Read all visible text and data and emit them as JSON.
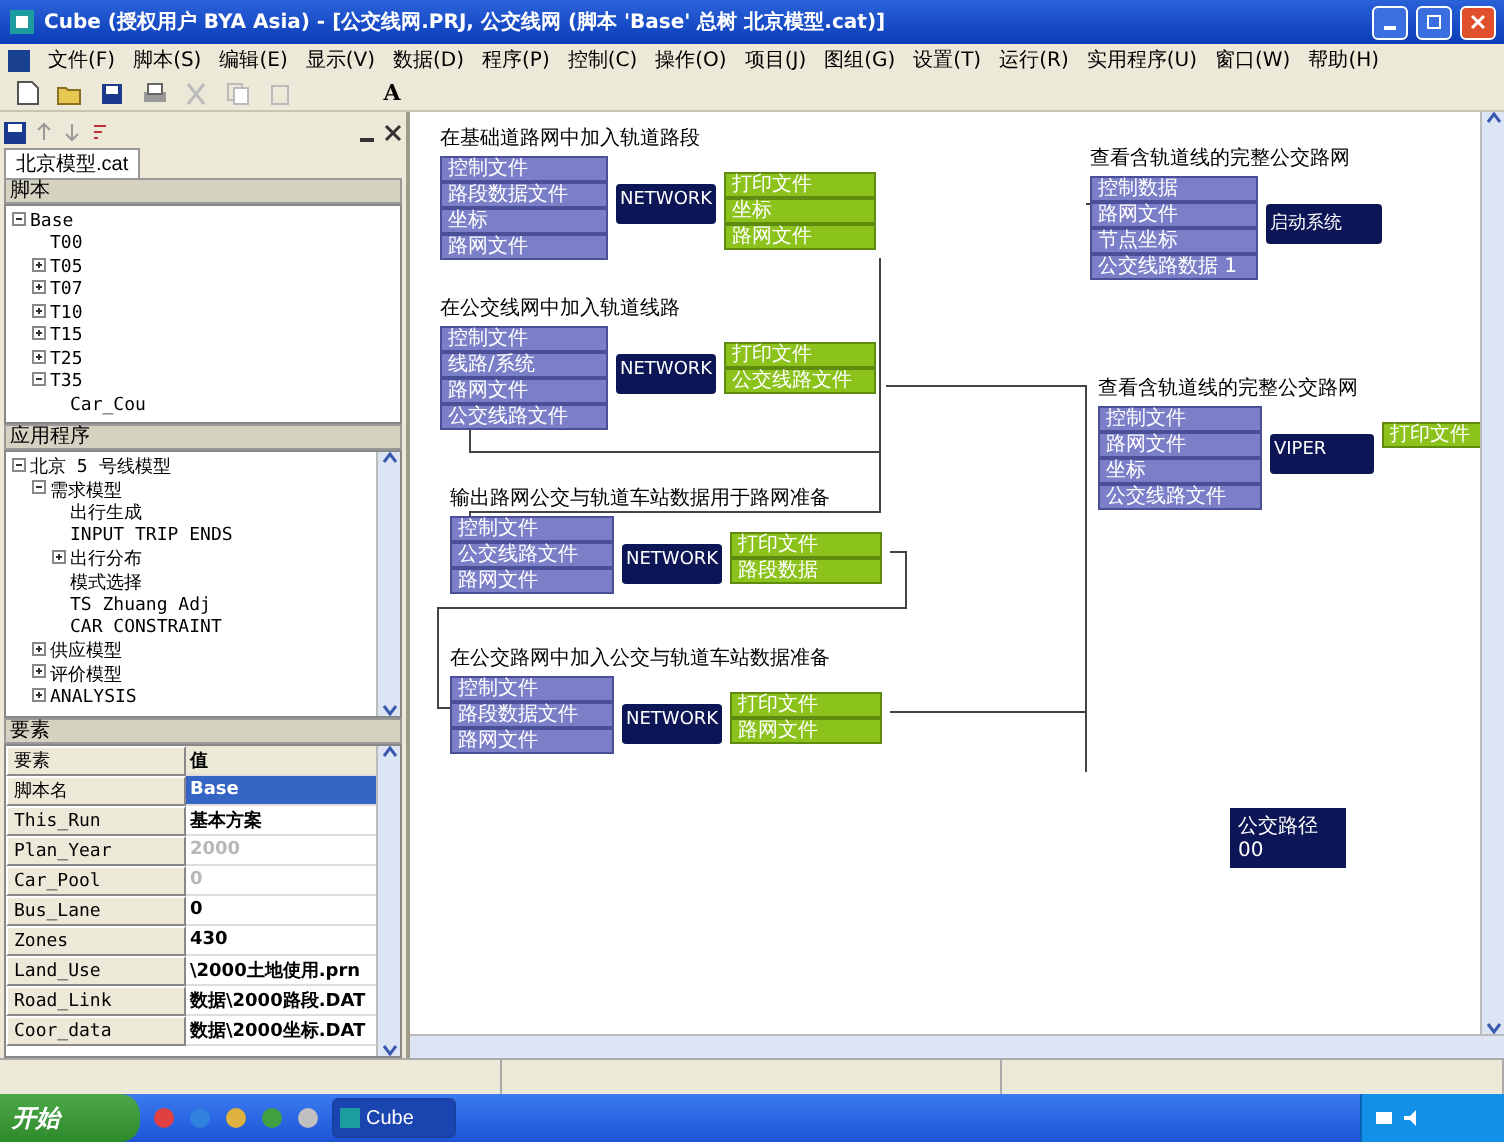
{
  "window": {
    "title": "Cube (授权用户 BYA Asia) - [公交线网.PRJ, 公交线网 (脚本 'Base' 总树 北京模型.cat)]"
  },
  "menu": [
    "文件(F)",
    "脚本(S)",
    "编辑(E)",
    "显示(V)",
    "数据(D)",
    "程序(P)",
    "控制(C)",
    "操作(O)",
    "项目(J)",
    "图组(G)",
    "设置(T)",
    "运行(R)",
    "实用程序(U)",
    "窗口(W)",
    "帮助(H)"
  ],
  "toolbar": {
    "font_button": "A"
  },
  "left_panel": {
    "tab": "北京模型.cat",
    "scripts": {
      "heading": "脚本",
      "tree": [
        {
          "label": "Base",
          "expanded": true,
          "children": [
            {
              "label": "T00"
            },
            {
              "label": "T05",
              "expanded": false
            },
            {
              "label": "T07",
              "expanded": false
            },
            {
              "label": "T10",
              "expanded": false
            },
            {
              "label": "T15",
              "expanded": false
            },
            {
              "label": "T25",
              "expanded": false
            },
            {
              "label": "T35",
              "expanded": true,
              "children": [
                {
                  "label": "Car_Cou"
                }
              ]
            }
          ]
        }
      ]
    },
    "applications": {
      "heading": "应用程序",
      "tree": [
        {
          "label": "北京 5 号线模型",
          "expanded": true,
          "children": [
            {
              "label": "需求模型",
              "expanded": true,
              "children": [
                {
                  "label": "出行生成"
                },
                {
                  "label": "INPUT TRIP ENDS"
                },
                {
                  "label": "出行分布",
                  "expanded": false
                },
                {
                  "label": "模式选择"
                },
                {
                  "label": "TS Zhuang Adj"
                },
                {
                  "label": "CAR CONSTRAINT"
                }
              ]
            },
            {
              "label": "供应模型",
              "expanded": false
            },
            {
              "label": "评价模型",
              "expanded": false
            },
            {
              "label": "ANALYSIS",
              "expanded": false
            }
          ]
        }
      ]
    },
    "keys": {
      "heading": "要素",
      "columns": [
        "要素",
        "值"
      ],
      "rows": [
        {
          "key": "脚本名",
          "value": "Base",
          "selected": true,
          "disabled": false
        },
        {
          "key": "This_Run",
          "value": "基本方案",
          "selected": false,
          "disabled": false
        },
        {
          "key": "Plan_Year",
          "value": "2000",
          "selected": false,
          "disabled": true
        },
        {
          "key": "Car_Pool",
          "value": "0",
          "selected": false,
          "disabled": true
        },
        {
          "key": "Bus_Lane",
          "value": "0",
          "selected": false,
          "disabled": false
        },
        {
          "key": "Zones",
          "value": "430",
          "selected": false,
          "disabled": false
        },
        {
          "key": "Land_Use",
          "value": "\\2000土地使用.prn",
          "selected": false,
          "disabled": false
        },
        {
          "key": "Road_Link",
          "value": "数据\\2000路段.DAT",
          "selected": false,
          "disabled": false
        },
        {
          "key": "Coor_data",
          "value": "数据\\2000坐标.DAT",
          "selected": false,
          "disabled": false
        }
      ]
    }
  },
  "canvas": {
    "nodes": [
      {
        "title": "在基础道路网中加入轨道路段",
        "inputs": [
          "控制文件",
          "路段数据文件",
          "坐标",
          "路网文件"
        ],
        "program": "NETWORK",
        "outputs": [
          "打印文件",
          "坐标",
          "路网文件"
        ]
      },
      {
        "title": "在公交线网中加入轨道线路",
        "inputs": [
          "控制文件",
          "线路/系统",
          "路网文件",
          "公交线路文件"
        ],
        "program": "NETWORK",
        "outputs": [
          "打印文件",
          "公交线路文件"
        ]
      },
      {
        "title": "输出路网公交与轨道车站数据用于路网准备",
        "inputs": [
          "控制文件",
          "公交线路文件",
          "路网文件"
        ],
        "program": "NETWORK",
        "outputs": [
          "打印文件",
          "路段数据"
        ]
      },
      {
        "title": "在公交路网中加入公交与轨道车站数据准备",
        "inputs": [
          "控制文件",
          "路段数据文件",
          "路网文件"
        ],
        "program": "NETWORK",
        "outputs": [
          "打印文件",
          "路网文件"
        ]
      },
      {
        "title": "查看含轨道线的完整公交路网",
        "inputs": [
          "控制数据",
          "路网文件",
          "节点坐标",
          "公交线路数据 1"
        ],
        "program": "启动系统"
      },
      {
        "title": "查看含轨道线的完整公交路网",
        "inputs": [
          "控制文件",
          "路网文件",
          "坐标",
          "公交线路文件"
        ],
        "program": "VIPER",
        "outputs": [
          "打印文件"
        ]
      }
    ],
    "note": {
      "title": "公交路径",
      "text": "00"
    }
  },
  "taskbar": {
    "start": "开始",
    "tasks": [
      {
        "label": "Cube",
        "selected": true
      }
    ]
  }
}
